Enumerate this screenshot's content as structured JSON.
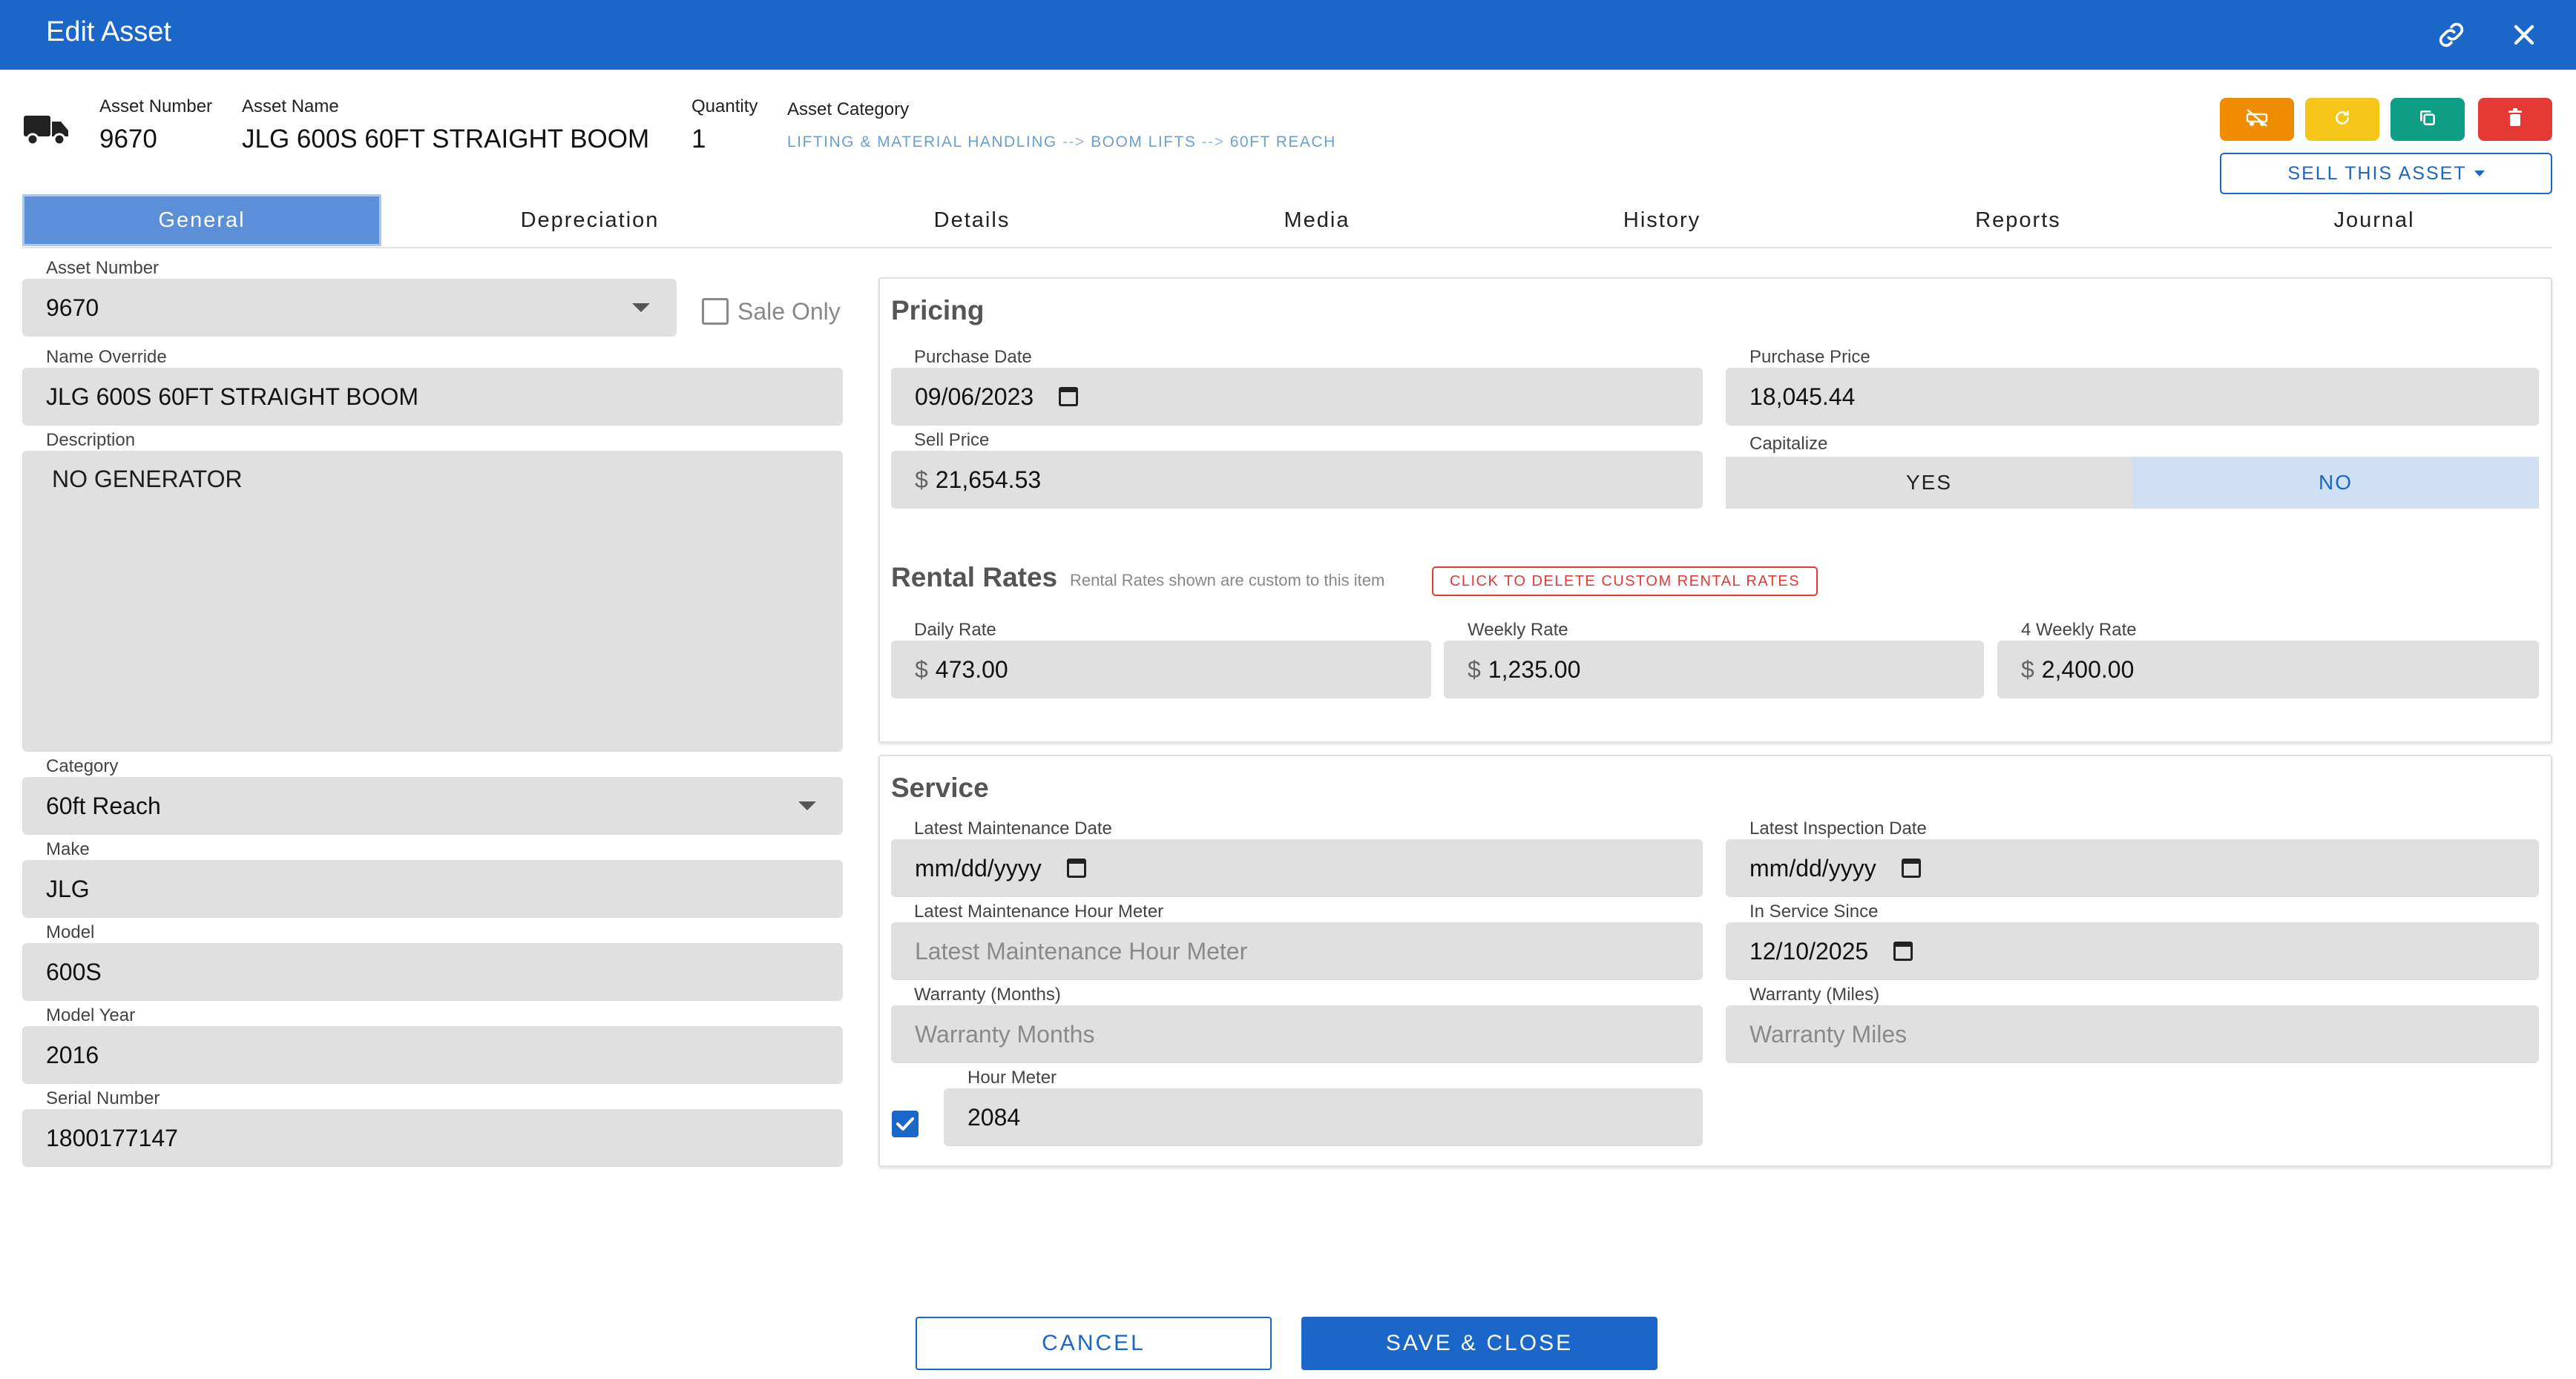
{
  "window": {
    "title": "Edit Asset",
    "link_icon": "link-icon",
    "close_icon": "close-icon"
  },
  "header": {
    "asset_number_label": "Asset Number",
    "asset_number": "9670",
    "asset_name_label": "Asset Name",
    "asset_name": "JLG 600S 60FT STRAIGHT BOOM",
    "quantity_label": "Quantity",
    "quantity": "1",
    "category_label": "Asset Category",
    "category_path": [
      "LIFTING & MATERIAL HANDLING",
      "BOOM LIFTS",
      "60FT REACH"
    ],
    "category_sep": " --> ",
    "actions": [
      {
        "icon": "vehicle-off-icon",
        "color": "#f08c00"
      },
      {
        "icon": "refresh-icon",
        "color": "#f5c518"
      },
      {
        "icon": "copy-icon",
        "color": "#0e9e86"
      },
      {
        "icon": "trash-icon",
        "color": "#e53935"
      }
    ],
    "sell_label": "SELL THIS ASSET"
  },
  "tabs": [
    "General",
    "Depreciation",
    "Details",
    "Media",
    "History",
    "Reports",
    "Journal"
  ],
  "general": {
    "asset_number_label": "Asset Number",
    "asset_number": "9670",
    "sale_only_label": "Sale Only",
    "sale_only": false,
    "name_override_label": "Name Override",
    "name_override": "JLG 600S 60FT STRAIGHT BOOM",
    "description_label": "Description",
    "description": "NO GENERATOR",
    "category_label": "Category",
    "category": "60ft Reach",
    "make_label": "Make",
    "make": "JLG",
    "model_label": "Model",
    "model": "600S",
    "model_year_label": "Model Year",
    "model_year": "2016",
    "serial_label": "Serial Number",
    "serial": "1800177147"
  },
  "pricing": {
    "title": "Pricing",
    "purchase_date_label": "Purchase Date",
    "purchase_date": "09/06/2023",
    "purchase_price_label": "Purchase Price",
    "purchase_price": "18,045.44",
    "sell_price_label": "Sell Price",
    "sell_price": "21,654.53",
    "capitalize_label": "Capitalize",
    "capitalize_yes": "YES",
    "capitalize_no": "NO",
    "capitalize": "NO"
  },
  "rental": {
    "title": "Rental Rates",
    "note": "Rental Rates shown are custom to this item",
    "delete_label": "CLICK TO DELETE CUSTOM RENTAL RATES",
    "currency": "$",
    "daily_label": "Daily Rate",
    "daily": "473.00",
    "weekly_label": "Weekly Rate",
    "weekly": "1,235.00",
    "four_weekly_label": "4 Weekly Rate",
    "four_weekly": "2,400.00"
  },
  "service": {
    "title": "Service",
    "maint_date_label": "Latest Maintenance Date",
    "maint_date": "mm/dd/yyyy",
    "insp_date_label": "Latest Inspection Date",
    "insp_date": "mm/dd/yyyy",
    "maint_hour_label": "Latest Maintenance Hour Meter",
    "maint_hour_placeholder": "Latest Maintenance Hour Meter",
    "in_service_label": "In Service Since",
    "in_service": "12/10/2025",
    "warranty_months_label": "Warranty (Months)",
    "warranty_months_placeholder": "Warranty Months",
    "warranty_miles_label": "Warranty (Miles)",
    "warranty_miles_placeholder": "Warranty Miles",
    "hour_meter_label": "Hour Meter",
    "hour_meter": "2084",
    "hour_meter_checked": true
  },
  "footer": {
    "cancel": "CANCEL",
    "save": "SAVE & CLOSE"
  },
  "colors": {
    "brand": "#1b66c9",
    "tab_active": "#5b8fd8",
    "field_bg": "#e0e0e0",
    "danger": "#e53935"
  }
}
